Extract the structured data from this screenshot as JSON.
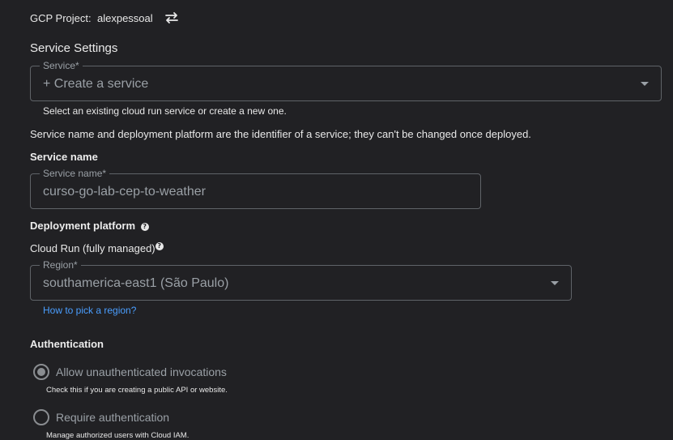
{
  "project": {
    "label": "GCP Project:",
    "name": "alexpessoal",
    "switch_icon": "swap-horizontal-icon"
  },
  "service_settings": {
    "title": "Service Settings",
    "service_field": {
      "label": "Service*",
      "value": "+ Create a service",
      "hint": "Select an existing cloud run service or create a new one."
    },
    "info_text": "Service name and deployment platform are the identifier of a service; they can't be changed once deployed."
  },
  "service_name": {
    "heading": "Service name",
    "field_label": "Service name*",
    "value": "curso-go-lab-cep-to-weather"
  },
  "deployment": {
    "heading": "Deployment platform",
    "platform": "Cloud Run (fully managed)",
    "region_label": "Region*",
    "region_value": "southamerica-east1 (São Paulo)",
    "region_link": "How to pick a region?"
  },
  "authentication": {
    "heading": "Authentication",
    "options": [
      {
        "label": "Allow unauthenticated invocations",
        "description": "Check this if you are creating a public API or website.",
        "selected": true
      },
      {
        "label": "Require authentication",
        "description": "Manage authorized users with Cloud IAM.",
        "selected": false
      }
    ]
  },
  "colors": {
    "background": "#212124",
    "link": "#4a9eff",
    "border": "#5f6368"
  }
}
